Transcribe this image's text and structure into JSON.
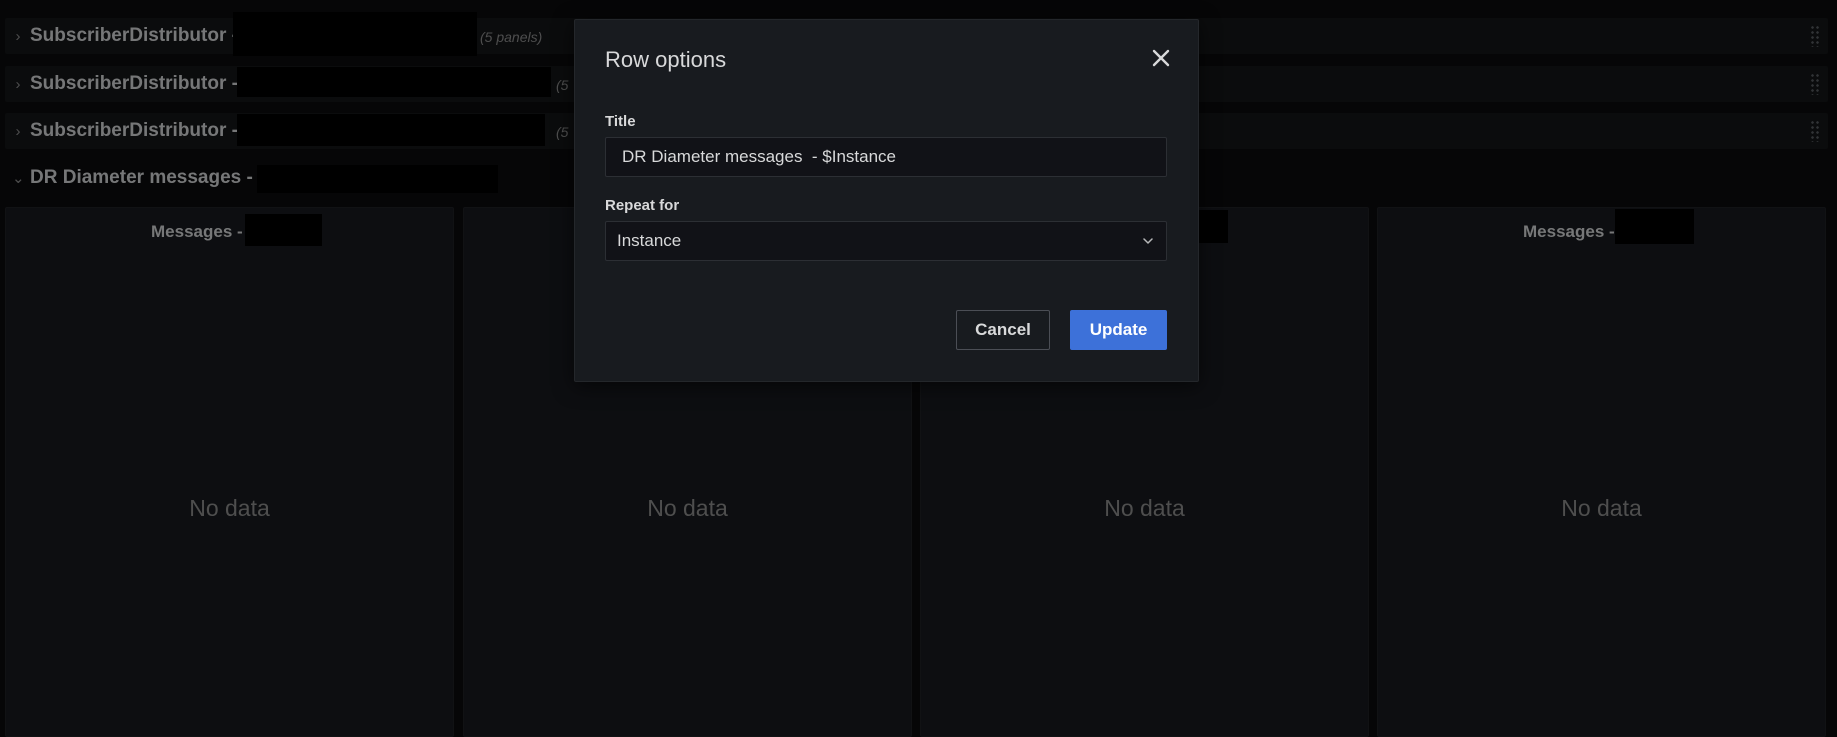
{
  "rows": [
    {
      "title": "SubscriberDistributor -",
      "count": "(5 panels)"
    },
    {
      "title": "SubscriberDistributor -",
      "count": "(5"
    },
    {
      "title": "SubscriberDistributor -",
      "count": "(5"
    }
  ],
  "open_row": {
    "title": "DR Diameter messages -"
  },
  "panels": [
    {
      "title": "Messages -",
      "no_data": "No data"
    },
    {
      "title": "",
      "no_data": "No data"
    },
    {
      "title": "",
      "no_data": "No data"
    },
    {
      "title": "Messages -",
      "no_data": "No data"
    }
  ],
  "modal": {
    "title": "Row options",
    "title_label": "Title",
    "title_value": "DR Diameter messages  - $Instance",
    "repeat_label": "Repeat for",
    "repeat_value": "Instance",
    "cancel_label": "Cancel",
    "update_label": "Update"
  },
  "icons": {
    "collapsed": "chevron-right-icon",
    "expanded": "chevron-down-icon",
    "close": "close-icon",
    "select": "chevron-down-icon",
    "drag": "drag-handle-icon"
  },
  "colors": {
    "background": "#0b0c0e",
    "panel": "#181b1f",
    "primary_button": "#3d71d9"
  }
}
